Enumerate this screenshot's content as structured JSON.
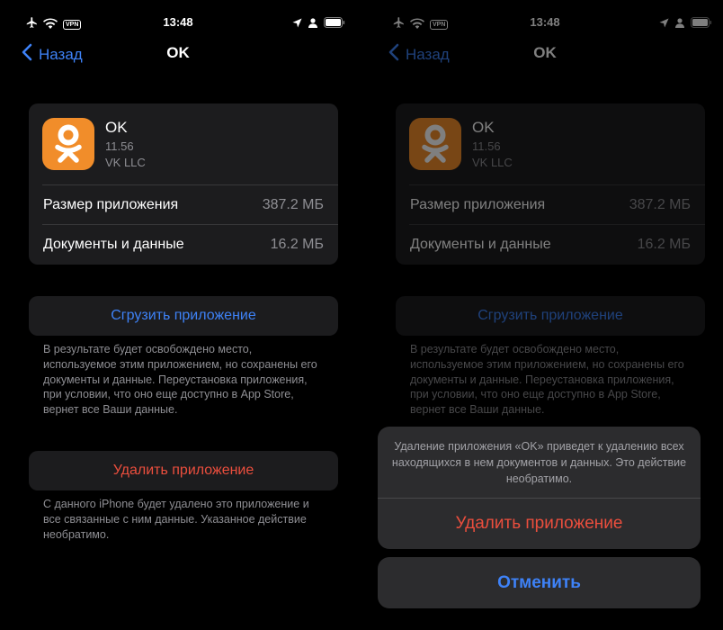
{
  "status_bar": {
    "time": "13:48",
    "vpn_label": "VPN"
  },
  "nav": {
    "back_label": "Назад",
    "title": "OK"
  },
  "app": {
    "name": "OK",
    "version": "11.56",
    "developer": "VK LLC",
    "icon": "ok-logo-icon",
    "icon_color": "#f18d2a"
  },
  "storage": {
    "app_size_label": "Размер приложения",
    "app_size_value": "387.2 МБ",
    "docs_label": "Документы и данные",
    "docs_value": "16.2 МБ"
  },
  "offload": {
    "button_label": "Сгрузить приложение",
    "note": "В результате будет освобождено место, используемое этим приложением, но сохранены его документы и данные. Переустановка приложения, при условии, что оно еще доступно в App Store, вернет все Ваши данные."
  },
  "delete": {
    "button_label": "Удалить приложение",
    "note": "С данного iPhone будет удалено это приложение и все связанные с ним данные. Указанное действие необратимо."
  },
  "action_sheet": {
    "message": "Удаление приложения «OK» приведет к удалению всех находящихся в нем документов и данных. Это действие необратимо.",
    "delete_label": "Удалить приложение",
    "cancel_label": "Отменить"
  },
  "colors": {
    "accent_blue": "#3e82f7",
    "destructive_red": "#eb4e3d",
    "card_bg": "#1c1c1e",
    "secondary_text": "#8e8e93"
  }
}
